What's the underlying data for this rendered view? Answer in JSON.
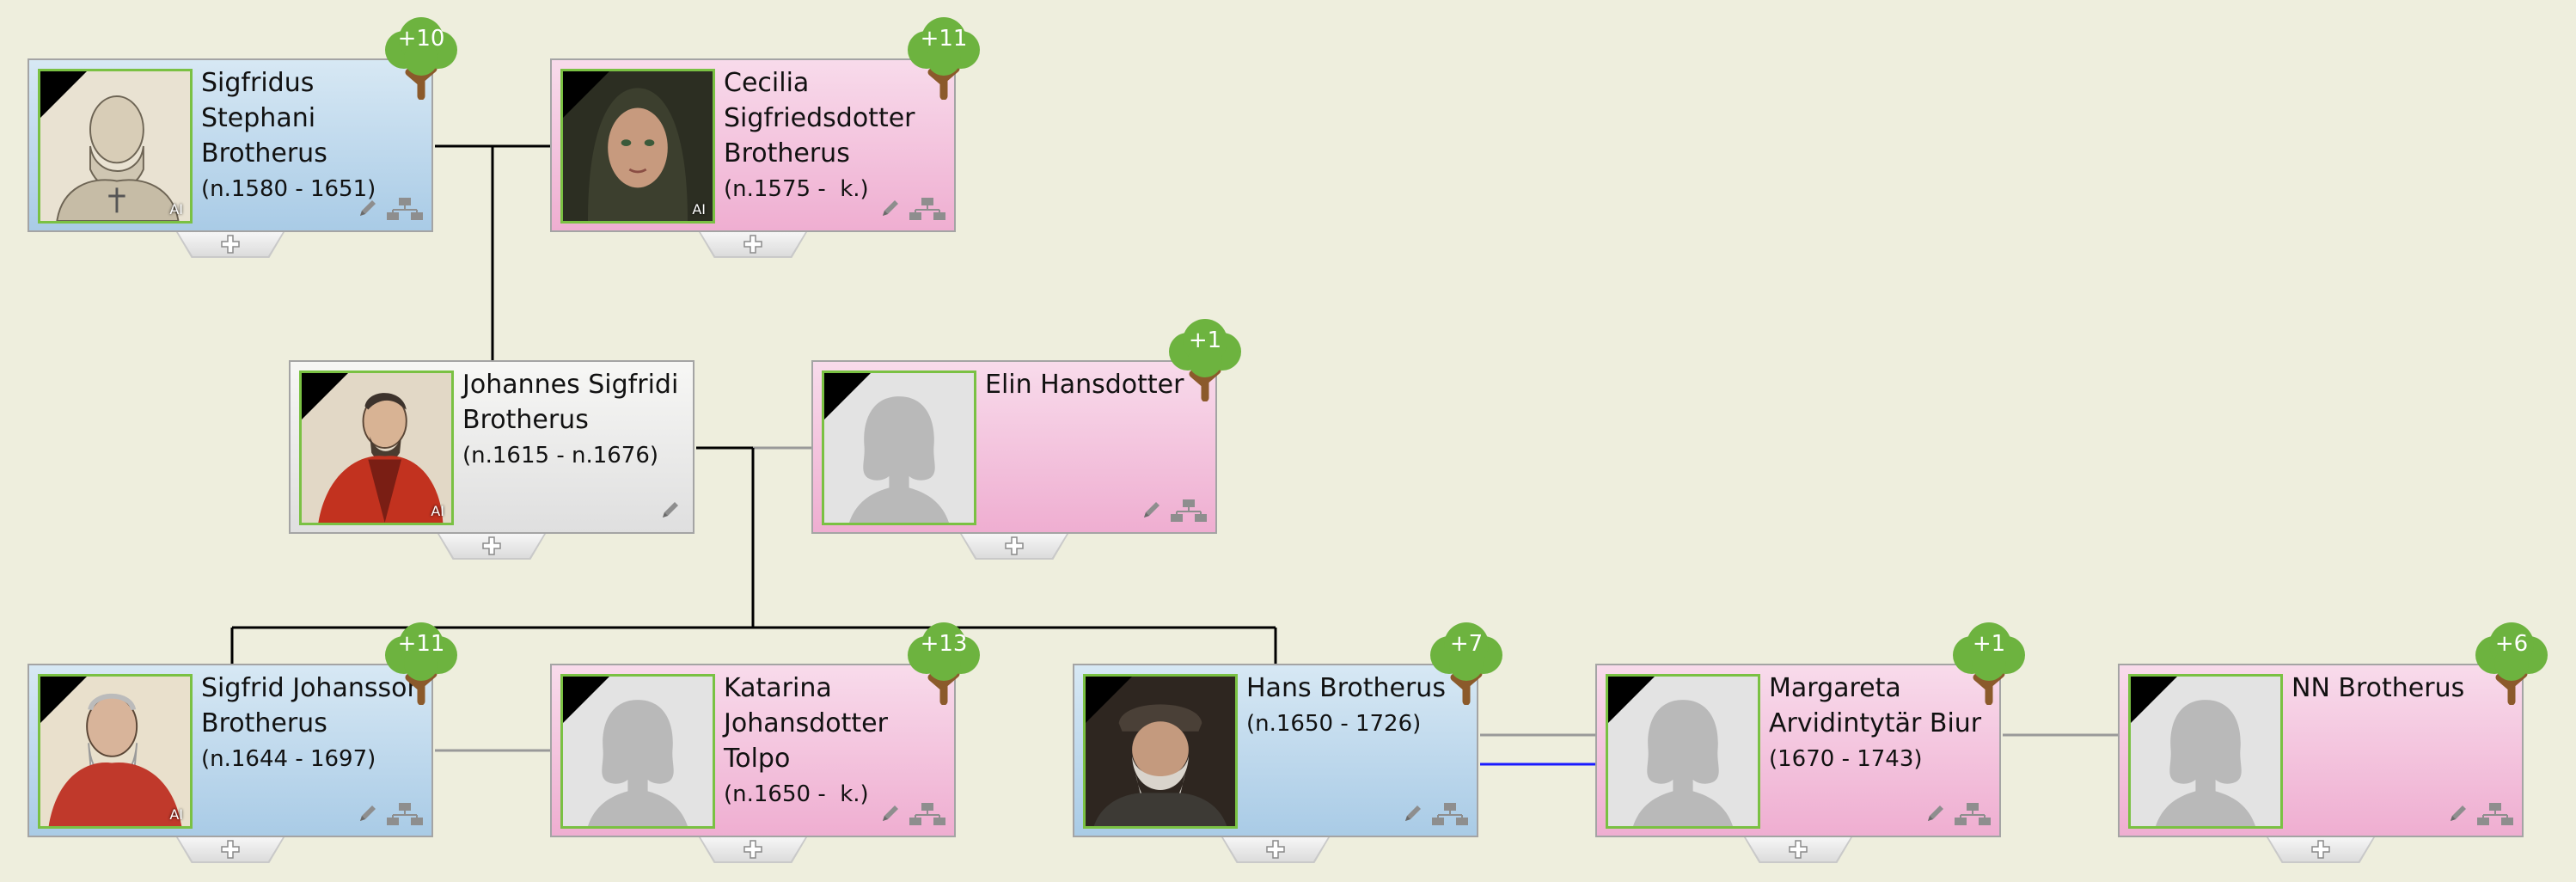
{
  "people": [
    {
      "id": "p1",
      "name": "Sigfridus Stephani Brotherus",
      "name_lines": [
        "Sigfridus",
        "Stephani",
        "Brotherus"
      ],
      "dates": "(n.1580 - 1651)",
      "gender": "male",
      "photo": "portrait-sketch",
      "ai": "AI",
      "badge": "+10",
      "tree_icon": true
    },
    {
      "id": "p2",
      "name": "Cecilia Sigfriedsdotter Brotherus",
      "name_lines": [
        "Cecilia",
        "Sigfriedsdotter",
        "Brotherus"
      ],
      "dates": "(n.1575 -  k.)",
      "gender": "female",
      "photo": "portrait-woman",
      "ai": "AI",
      "badge": "+11",
      "tree_icon": true
    },
    {
      "id": "p3",
      "name": "Johannes Sigfridi Brotherus",
      "name_lines": [
        "Johannes Sigfridi",
        "Brotherus"
      ],
      "dates": "(n.1615 - n.1676)",
      "gender": "neutral",
      "photo": "portrait-red-robe",
      "ai": "AI",
      "badge": "",
      "tree_icon": false
    },
    {
      "id": "p4",
      "name": "Elin Hansdotter",
      "name_lines": [
        "Elin Hansdotter"
      ],
      "dates": "",
      "gender": "female",
      "photo": "silhouette-female",
      "ai": "",
      "badge": "+1",
      "tree_icon": true
    },
    {
      "id": "p5",
      "name": "Sigfrid Johansson Brotherus",
      "name_lines": [
        "Sigfrid Johansson",
        "Brotherus"
      ],
      "dates": "(n.1644 - 1697)",
      "gender": "male",
      "photo": "portrait-red-bishop",
      "ai": "AI",
      "badge": "+11",
      "tree_icon": true
    },
    {
      "id": "p6",
      "name": "Katarina Johansdotter Tolpo",
      "name_lines": [
        "Katarina",
        "Johansdotter",
        "Tolpo"
      ],
      "dates": "(n.1650 -  k.)",
      "gender": "female",
      "photo": "silhouette-female",
      "ai": "",
      "badge": "+13",
      "tree_icon": true
    },
    {
      "id": "p7",
      "name": "Hans Brotherus",
      "name_lines": [
        "Hans Brotherus"
      ],
      "dates": "(n.1650 - 1726)",
      "gender": "male",
      "photo": "portrait-old-man",
      "ai": "",
      "badge": "+7",
      "tree_icon": true
    },
    {
      "id": "p8",
      "name": "Margareta Arvidintytär Biur",
      "name_lines": [
        "Margareta",
        "Arvidintytär Biur"
      ],
      "dates": "(1670 - 1743)",
      "gender": "female",
      "photo": "silhouette-female",
      "ai": "",
      "badge": "+1",
      "tree_icon": true
    },
    {
      "id": "p9",
      "name": "NN Brotherus",
      "name_lines": [
        "NN Brotherus"
      ],
      "dates": "",
      "gender": "female",
      "photo": "silhouette-female",
      "ai": "",
      "badge": "+6",
      "tree_icon": true
    }
  ],
  "icons": {
    "edit": "pencil-icon",
    "tree": "family-tree-icon",
    "add": "plus-icon",
    "badge": "tree-badge-icon",
    "mourning": "mourning-ribbon"
  },
  "colors": {
    "background": "#eeeedd",
    "male": "#a9cbe6",
    "female": "#efaed1",
    "photo_border": "#7ac143",
    "badge_green": "#6db33f",
    "badge_trunk": "#8b5a2b",
    "spouse_line_highlight": "#1a1aff"
  }
}
